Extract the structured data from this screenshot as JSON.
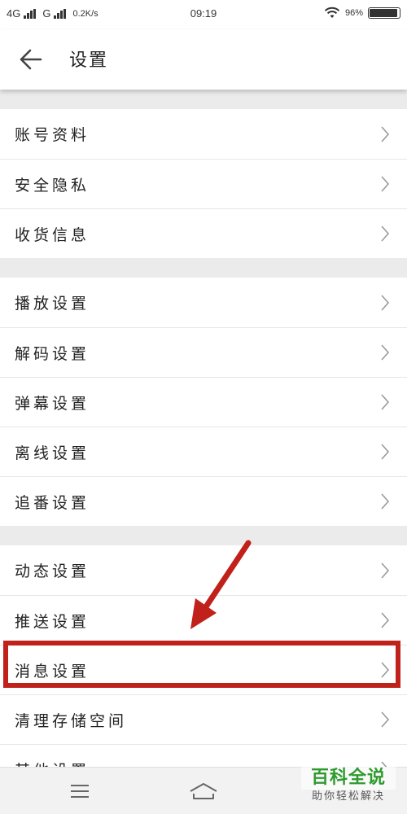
{
  "status_bar": {
    "network1": "4G",
    "network2": "G",
    "speed": "0.2K/s",
    "time": "09:19",
    "battery_text": "96%",
    "battery_level": 0.96
  },
  "header": {
    "title": "设置"
  },
  "groups": [
    {
      "items": [
        {
          "label": "账号资料"
        },
        {
          "label": "安全隐私"
        },
        {
          "label": "收货信息"
        }
      ]
    },
    {
      "items": [
        {
          "label": "播放设置"
        },
        {
          "label": "解码设置"
        },
        {
          "label": "弹幕设置"
        },
        {
          "label": "离线设置"
        },
        {
          "label": "追番设置"
        }
      ]
    },
    {
      "items": [
        {
          "label": "动态设置"
        },
        {
          "label": "推送设置"
        },
        {
          "label": "消息设置"
        },
        {
          "label": "清理存储空间"
        },
        {
          "label": "其他设置"
        }
      ]
    }
  ],
  "annotation": {
    "highlight_color": "#c0211a"
  },
  "watermark": {
    "title": "百科全说",
    "subtitle": "助你轻松解决"
  }
}
